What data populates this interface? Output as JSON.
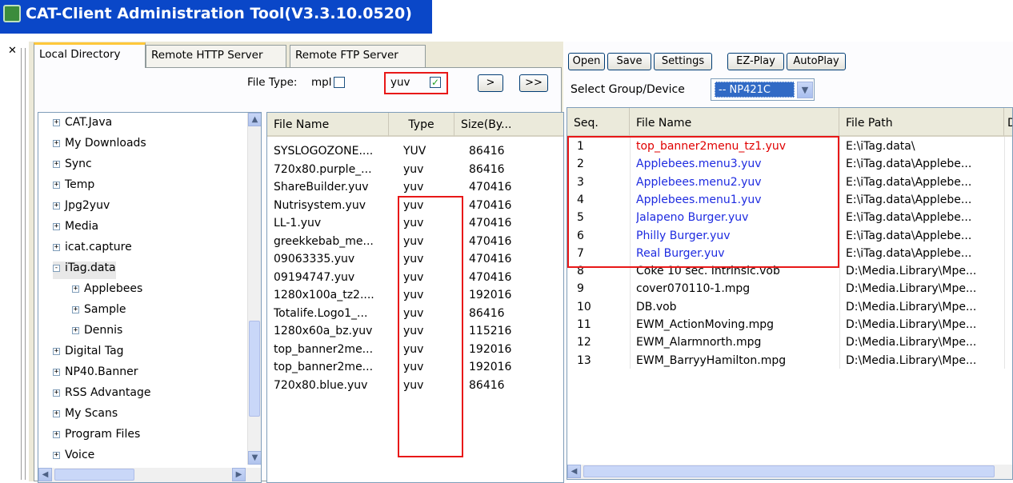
{
  "window": {
    "title": "CAT-Client Administration Tool(V3.3.10.0520)"
  },
  "left": {
    "tabs": [
      "Local Directory",
      "Remote HTTP Server",
      "Remote FTP Server"
    ],
    "file_type_label": "File Type:",
    "mpl_label": "mpl",
    "yuv_label": "yuv",
    "mpl_checked": false,
    "yuv_checked": true,
    "add_button": ">",
    "add_all_button": ">>",
    "tree": [
      {
        "label": "CAT.Java",
        "expander": "+"
      },
      {
        "label": "My Downloads",
        "expander": "+"
      },
      {
        "label": "Sync",
        "expander": "+"
      },
      {
        "label": "Temp",
        "expander": "+"
      },
      {
        "label": "Jpg2yuv",
        "expander": "+"
      },
      {
        "label": "Media",
        "expander": "+"
      },
      {
        "label": "icat.capture",
        "expander": "+"
      },
      {
        "label": "iTag.data",
        "expander": "-"
      },
      {
        "label": "Applebees",
        "expander": "+"
      },
      {
        "label": "Sample",
        "expander": "+"
      },
      {
        "label": "Dennis",
        "expander": "+"
      },
      {
        "label": "Digital Tag",
        "expander": "+"
      },
      {
        "label": "NP40.Banner",
        "expander": "+"
      },
      {
        "label": "RSS Advantage",
        "expander": "+"
      },
      {
        "label": "My Scans",
        "expander": "+"
      },
      {
        "label": "Program Files",
        "expander": "+"
      },
      {
        "label": "Voice",
        "expander": "+"
      }
    ],
    "file_headers": [
      "File Name",
      "Type",
      "Size(By..."
    ],
    "files": [
      {
        "name": "SYSLOGOZONE....",
        "type": "YUV",
        "size": "86416"
      },
      {
        "name": "720x80.purple_...",
        "type": "yuv",
        "size": "86416"
      },
      {
        "name": "ShareBuilder.yuv",
        "type": "yuv",
        "size": "470416"
      },
      {
        "name": "Nutrisystem.yuv",
        "type": "yuv",
        "size": "470416"
      },
      {
        "name": "LL-1.yuv",
        "type": "yuv",
        "size": "470416"
      },
      {
        "name": "greekkebab_me...",
        "type": "yuv",
        "size": "470416"
      },
      {
        "name": "09063335.yuv",
        "type": "yuv",
        "size": "470416"
      },
      {
        "name": "09194747.yuv",
        "type": "yuv",
        "size": "470416"
      },
      {
        "name": "1280x100a_tz2....",
        "type": "yuv",
        "size": "192016"
      },
      {
        "name": "Totalife.Logo1_...",
        "type": "yuv",
        "size": "86416"
      },
      {
        "name": "1280x60a_bz.yuv",
        "type": "yuv",
        "size": "115216"
      },
      {
        "name": "top_banner2me...",
        "type": "yuv",
        "size": "192016"
      },
      {
        "name": "top_banner2me...",
        "type": "yuv",
        "size": "192016"
      },
      {
        "name": "720x80.blue.yuv",
        "type": "yuv",
        "size": "86416"
      }
    ]
  },
  "right": {
    "buttons": [
      "Open",
      "Save",
      "Settings",
      "EZ-Play",
      "AutoPlay"
    ],
    "group_label": "Select Group/Device",
    "group_value": "-- NP421C",
    "headers": [
      "Seq.",
      "File Name",
      "File Path",
      "D"
    ],
    "playlist": [
      {
        "seq": "1",
        "name": "top_banner2menu_tz1.yuv",
        "path": "E:\\iTag.data\\",
        "color": "#e00000"
      },
      {
        "seq": "2",
        "name": "Applebees.menu3.yuv",
        "path": "E:\\iTag.data\\Applebe...",
        "color": "#1e2be0"
      },
      {
        "seq": "3",
        "name": "Applebees.menu2.yuv",
        "path": "E:\\iTag.data\\Applebe...",
        "color": "#1e2be0"
      },
      {
        "seq": "4",
        "name": "Applebees.menu1.yuv",
        "path": "E:\\iTag.data\\Applebe...",
        "color": "#1e2be0"
      },
      {
        "seq": "5",
        "name": "Jalapeno Burger.yuv",
        "path": "E:\\iTag.data\\Applebe...",
        "color": "#1e2be0"
      },
      {
        "seq": "6",
        "name": "Philly Burger.yuv",
        "path": "E:\\iTag.data\\Applebe...",
        "color": "#1e2be0"
      },
      {
        "seq": "7",
        "name": "Real Burger.yuv",
        "path": "E:\\iTag.data\\Applebe...",
        "color": "#1e2be0"
      },
      {
        "seq": "8",
        "name": "Coke 10 sec. Intrinsic.vob",
        "path": "D:\\Media.Library\\Mpe...",
        "color": "#000000"
      },
      {
        "seq": "9",
        "name": "cover070110-1.mpg",
        "path": "D:\\Media.Library\\Mpe...",
        "color": "#000000"
      },
      {
        "seq": "10",
        "name": "DB.vob",
        "path": "D:\\Media.Library\\Mpe...",
        "color": "#000000"
      },
      {
        "seq": "11",
        "name": "EWM_ActionMoving.mpg",
        "path": "D:\\Media.Library\\Mpe...",
        "color": "#000000"
      },
      {
        "seq": "12",
        "name": "EWM_Alarmnorth.mpg",
        "path": "D:\\Media.Library\\Mpe...",
        "color": "#000000"
      },
      {
        "seq": "13",
        "name": "EWM_BarryyHamilton.mpg",
        "path": "D:\\Media.Library\\Mpe...",
        "color": "#000000"
      }
    ]
  },
  "icons": {
    "close": "close-icon",
    "app": "app-icon"
  },
  "colors": {
    "titlebar": "#0a47c8",
    "highlight_box": "#e81818",
    "link_blue": "#1e2be0"
  }
}
